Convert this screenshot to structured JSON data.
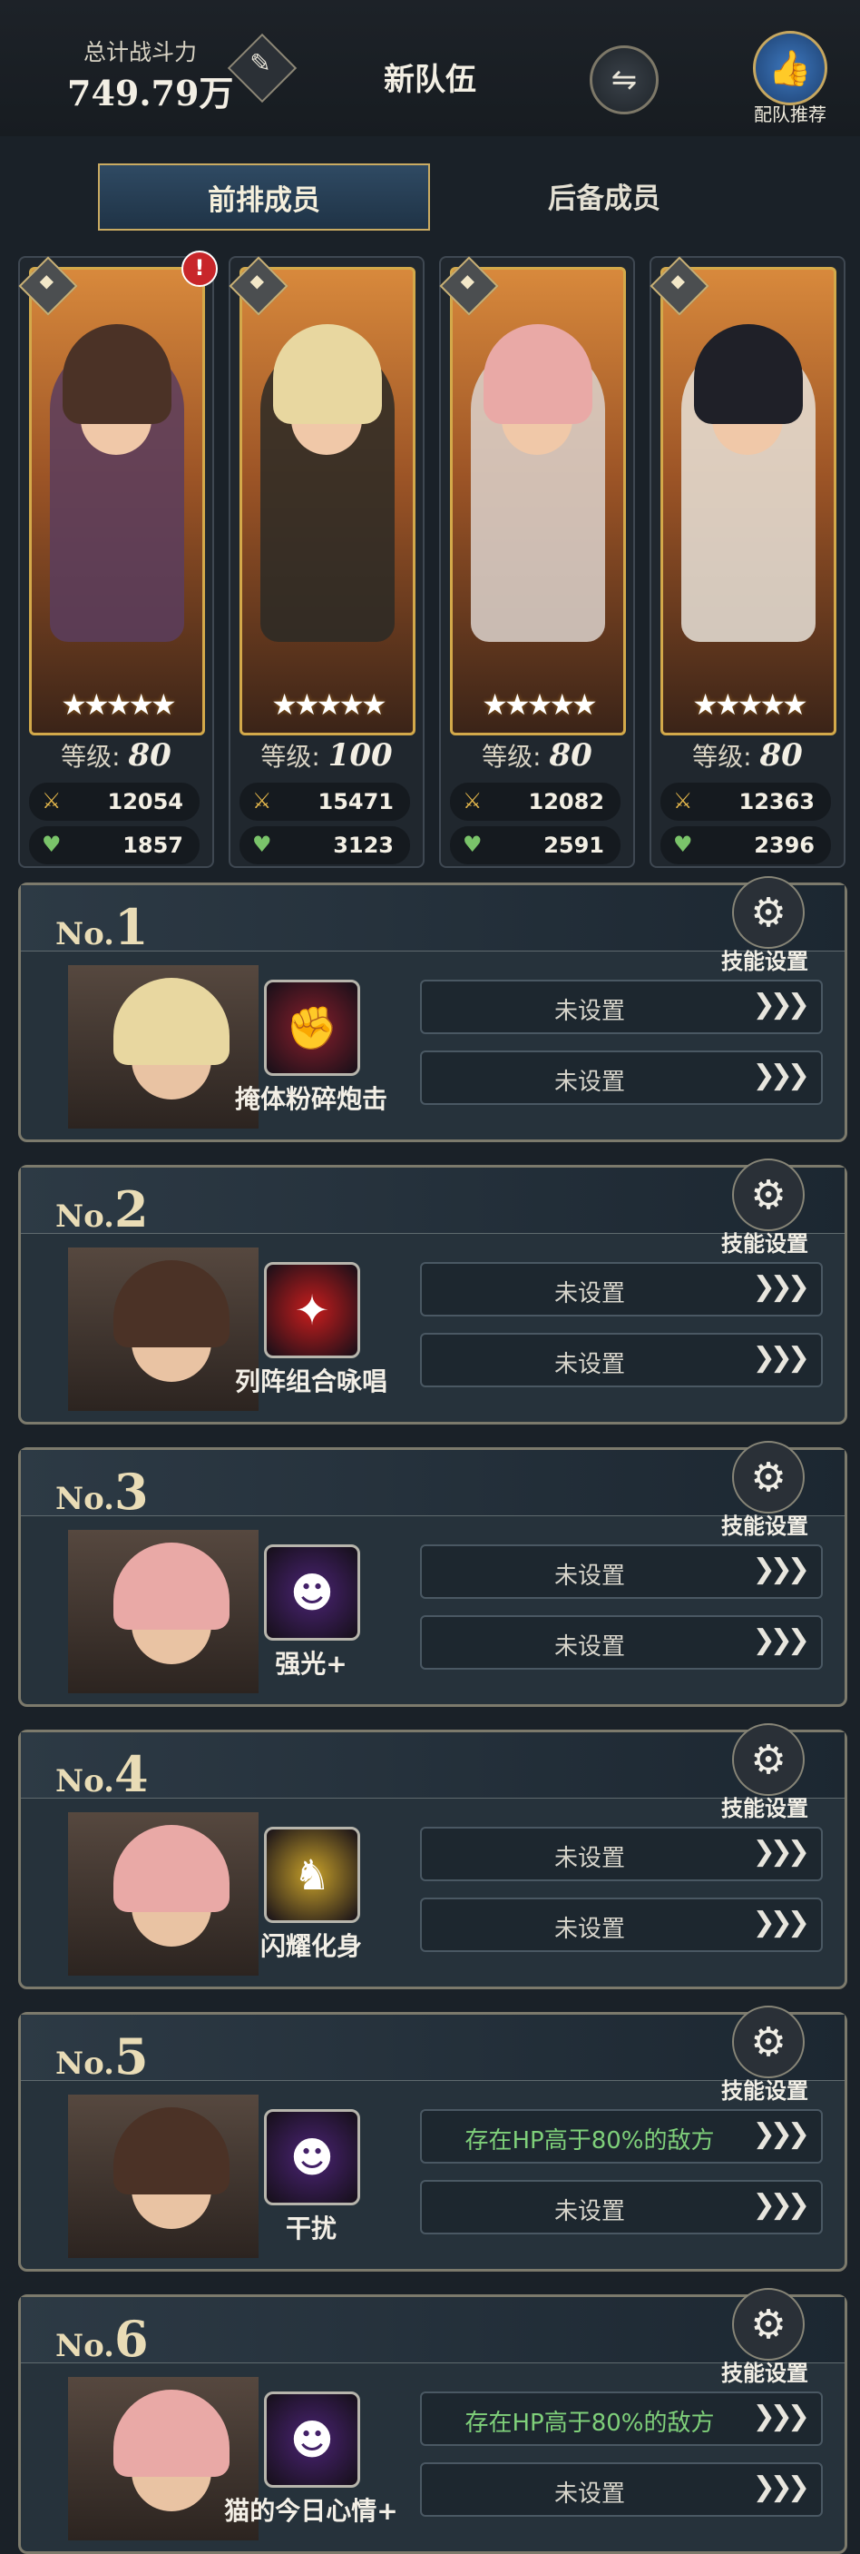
{
  "header": {
    "power_label": "总计战斗力",
    "power_value": "749.79万",
    "team_name": "新队伍",
    "recommend_label": "配队推荐"
  },
  "tabs": [
    {
      "label": "前排成员",
      "active": true
    },
    {
      "label": "后备成员",
      "active": false
    }
  ],
  "characters": [
    {
      "level_label": "等级:",
      "level": "80",
      "attack": "12054",
      "hp": "1857",
      "stars": "★★★★★",
      "alert": "!",
      "hair": "#4b3226",
      "bg": "#5a3d5e"
    },
    {
      "level_label": "等级:",
      "level": "100",
      "attack": "15471",
      "hp": "3123",
      "stars": "★★★★★",
      "hair": "#e8d7a0",
      "bg": "#2b2a26"
    },
    {
      "level_label": "等级:",
      "level": "80",
      "attack": "12082",
      "hp": "2591",
      "stars": "★★★★★",
      "hair": "#e9a9a6",
      "bg": "#dcd2cc"
    },
    {
      "level_label": "等级:",
      "level": "80",
      "attack": "12363",
      "hp": "2396",
      "stars": "★★★★★",
      "hair": "#1f2028",
      "bg": "#e7e2d8"
    }
  ],
  "slot_common": {
    "no_prefix": "No.",
    "settings_label": "技能设置",
    "unset": "未设置"
  },
  "slots": [
    {
      "number": "1",
      "skill": "掩体粉碎炮击",
      "cond1": "未设置",
      "cond2": "未设置",
      "cond1_green": false,
      "icon_color": "#8a1f2c",
      "icon_glyph": "✊",
      "hair": "#e8d7a0"
    },
    {
      "number": "2",
      "skill": "列阵组合咏唱",
      "cond1": "未设置",
      "cond2": "未设置",
      "cond1_green": false,
      "icon_color": "#c81d1d",
      "icon_glyph": "✦",
      "hair": "#4b3226"
    },
    {
      "number": "3",
      "skill": "强光+",
      "cond1": "未设置",
      "cond2": "未设置",
      "cond1_green": false,
      "icon_color": "#4b2475",
      "icon_glyph": "☻",
      "hair": "#e9a9a6"
    },
    {
      "number": "4",
      "skill": "闪耀化身",
      "cond1": "未设置",
      "cond2": "未设置",
      "cond1_green": false,
      "icon_color": "#c9a22a",
      "icon_glyph": "♞",
      "hair": "#e9a9a6"
    },
    {
      "number": "5",
      "skill": "干扰",
      "cond1": "存在HP高于80%的敌方",
      "cond2": "未设置",
      "cond1_green": true,
      "icon_color": "#4b2475",
      "icon_glyph": "☻",
      "hair": "#4b3226"
    },
    {
      "number": "6",
      "skill": "猫的今日心情+",
      "cond1": "存在HP高于80%的敌方",
      "cond2": "未设置",
      "cond1_green": true,
      "icon_color": "#4b2475",
      "icon_glyph": "☻",
      "hair": "#e9a9a6"
    }
  ],
  "icons": {
    "quill": "feather-icon",
    "swap": "swap-icon",
    "thumb": "thumbs-up-icon",
    "gear": "gear-icon",
    "sword": "sword-icon",
    "heart": "heart-icon",
    "arrows": "chevrons-right-icon"
  },
  "colors": {
    "accent_gold": "#c9ab62",
    "condition_green": "#7fd07a",
    "alert_red": "#c8262a"
  }
}
